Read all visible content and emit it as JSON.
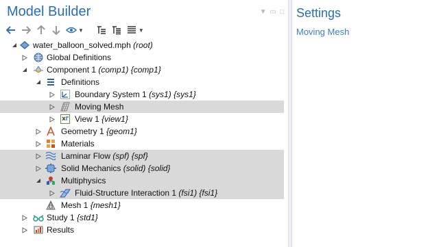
{
  "model_builder": {
    "title": "Model Builder"
  },
  "toolbar": {
    "icons": [
      "arrow-left-icon",
      "arrow-right-icon",
      "arrow-up-icon",
      "arrow-down-icon",
      "eye-icon",
      "collapse-all-icon",
      "expand-all-icon",
      "list-icon"
    ]
  },
  "tree": {
    "root": {
      "name": "water_balloon_solved.mph",
      "tag": "(root)"
    },
    "global_definitions": {
      "name": "Global Definitions"
    },
    "component": {
      "name": "Component 1",
      "tag": "(comp1) {comp1}"
    },
    "definitions": {
      "name": "Definitions"
    },
    "boundary_system": {
      "name": "Boundary System 1",
      "tag": "(sys1) {sys1}"
    },
    "moving_mesh": {
      "name": "Moving Mesh"
    },
    "view": {
      "name": "View 1",
      "tag": "{view1}"
    },
    "geometry": {
      "name": "Geometry 1",
      "tag": "{geom1}"
    },
    "materials": {
      "name": "Materials"
    },
    "laminar_flow": {
      "name": "Laminar Flow",
      "tag": "(spf) {spf}"
    },
    "solid_mechanics": {
      "name": "Solid Mechanics",
      "tag": "(solid) {solid}"
    },
    "multiphysics": {
      "name": "Multiphysics"
    },
    "fsi": {
      "name": "Fluid-Structure Interaction 1",
      "tag": "(fsi1) {fsi1}"
    },
    "mesh": {
      "name": "Mesh 1",
      "tag": "{mesh1}"
    },
    "study": {
      "name": "Study 1",
      "tag": "{std1}"
    },
    "results": {
      "name": "Results"
    }
  },
  "settings": {
    "title": "Settings",
    "subtitle": "Moving Mesh"
  },
  "colors": {
    "accent": "#2a6db5",
    "selection": "#d9d9d9"
  }
}
